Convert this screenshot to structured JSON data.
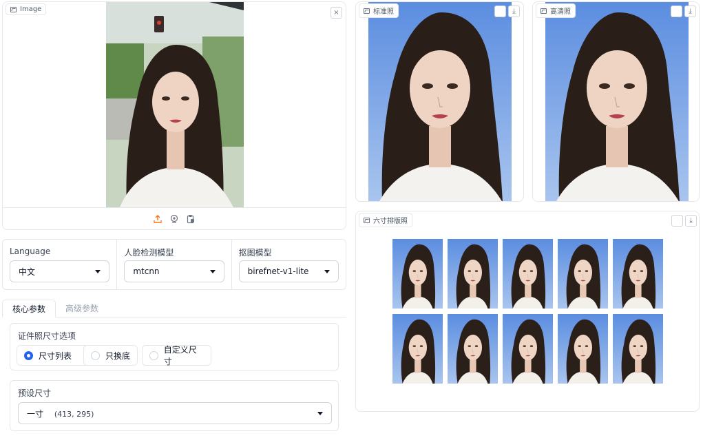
{
  "image_input": {
    "label": "Image",
    "close_glyph": "×",
    "icons": [
      "upload-icon",
      "webcam-icon",
      "clipboard-icon"
    ],
    "accent_color": "#f97316"
  },
  "outputs": {
    "standard": {
      "label": "标准照"
    },
    "hd": {
      "label": "高清照"
    },
    "layout": {
      "label": "六寸排版照"
    },
    "download_glyph": "⤓"
  },
  "selectors": {
    "language": {
      "label": "Language",
      "value": "中文"
    },
    "face_model": {
      "label": "人脸检测模型",
      "value": "mtcnn"
    },
    "matting_model": {
      "label": "抠图模型",
      "value": "birefnet-v1-lite"
    }
  },
  "tabs": [
    "核心参数",
    "高级参数"
  ],
  "size_options": {
    "label": "证件照尺寸选项",
    "options": [
      "尺寸列表",
      "只换底",
      "自定义尺寸"
    ],
    "selected_index": 0,
    "accent_color": "#2563eb"
  },
  "preset": {
    "label": "预设尺寸",
    "value": "一寸",
    "dims": "(413, 295)"
  }
}
